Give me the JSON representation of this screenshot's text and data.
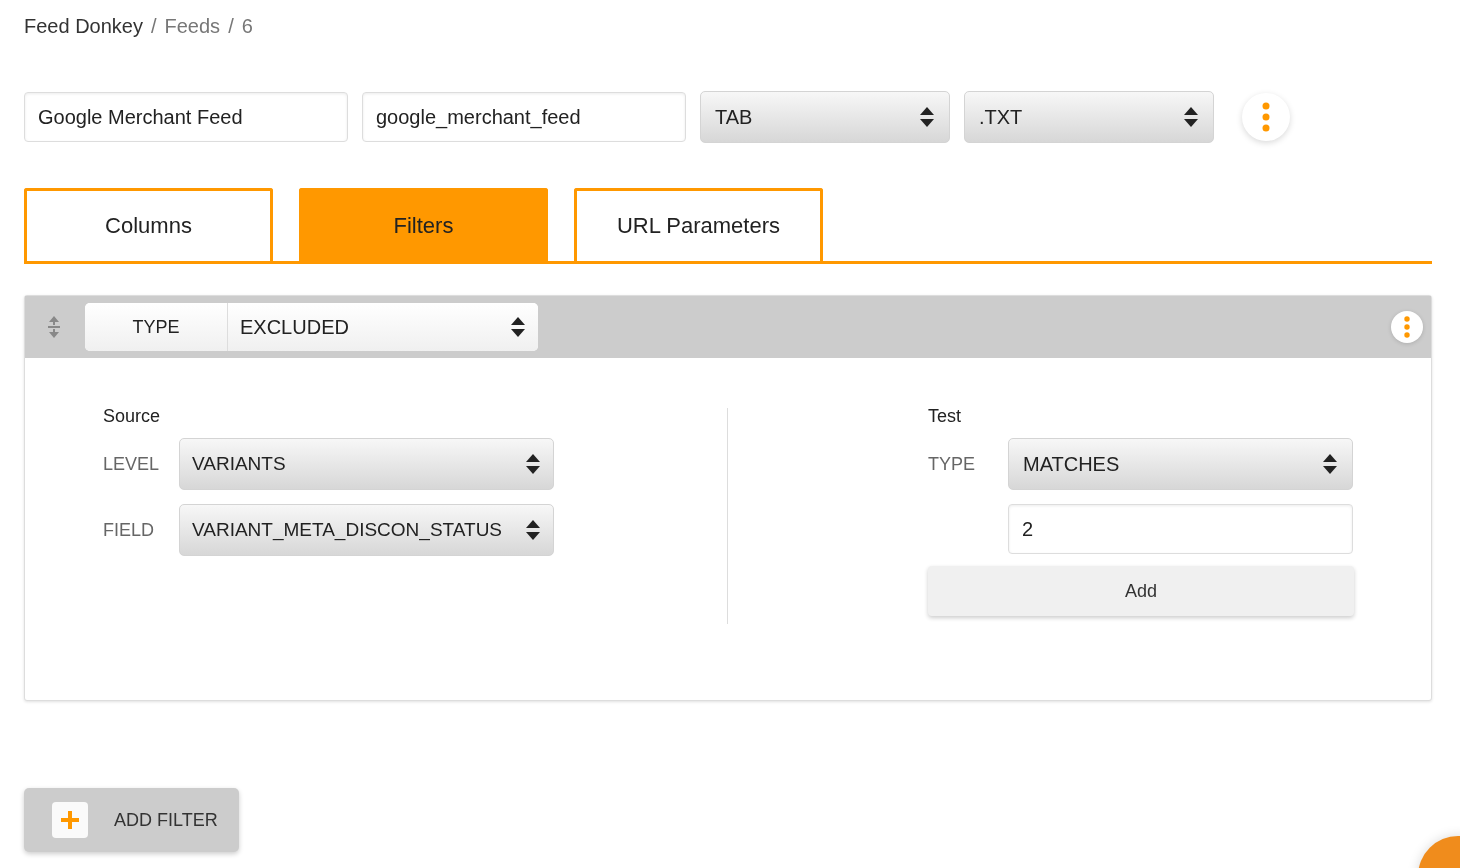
{
  "breadcrumb_separator": "/",
  "breadcrumb": [
    {
      "text": "Feed Donkey",
      "current": false
    },
    {
      "text": "Feeds",
      "current": true
    },
    {
      "text": "6",
      "current": true
    }
  ],
  "feed": {
    "name": "Google Merchant Feed",
    "slug": "google_merchant_feed",
    "delimiter": "TAB",
    "extension": ".TXT"
  },
  "tabs": [
    {
      "label": "Columns",
      "selected": false
    },
    {
      "label": "Filters",
      "selected": true
    },
    {
      "label": "URL Parameters",
      "selected": false
    }
  ],
  "filter": {
    "type_label": "TYPE",
    "type_value": "EXCLUDED",
    "source": {
      "title": "Source",
      "level_label": "LEVEL",
      "level_value": "VARIANTS",
      "field_label": "FIELD",
      "field_value": "VARIANT_META_DISCON_STATUS"
    },
    "test": {
      "title": "Test",
      "type_label": "TYPE",
      "type_value": "MATCHES",
      "value": "2",
      "add_button": "Add"
    }
  },
  "add_filter_button": "ADD FILTER"
}
